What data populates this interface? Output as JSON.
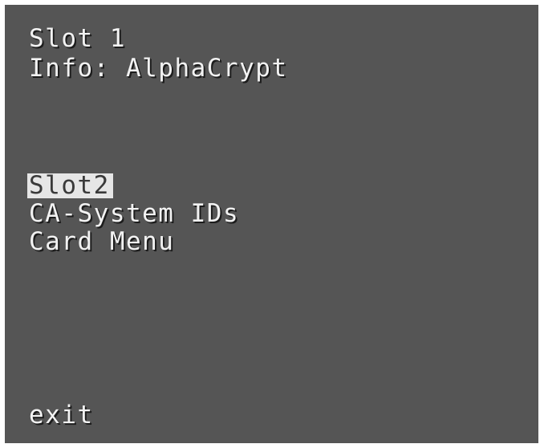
{
  "header": {
    "slot_title": "Slot 1",
    "info_line": "Info: AlphaCrypt"
  },
  "menu": {
    "items": [
      {
        "label": "Slot2",
        "selected": true
      },
      {
        "label": "CA-System IDs",
        "selected": false
      },
      {
        "label": "Card Menu",
        "selected": false
      }
    ]
  },
  "footer": {
    "exit_label": "exit"
  },
  "colors": {
    "background": "#555555",
    "text": "#f2f2f2",
    "highlight": "#e6e6e6"
  }
}
